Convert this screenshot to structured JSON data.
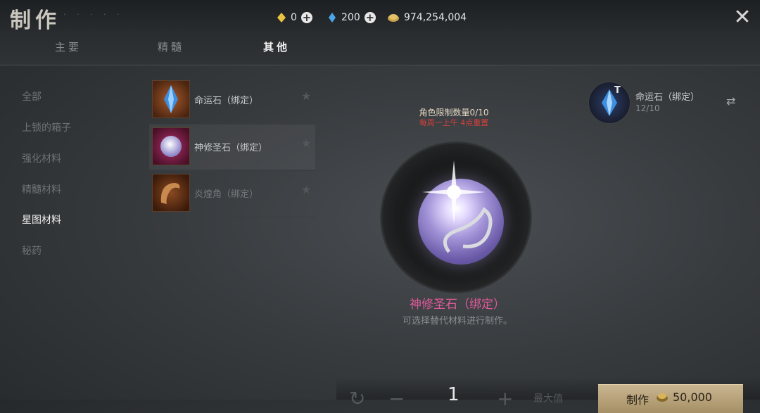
{
  "header": {
    "title": "制作",
    "currencies": [
      {
        "icon": "gold-diamond-icon",
        "value": "0"
      },
      {
        "icon": "blue-crystal-icon",
        "value": "200"
      },
      {
        "icon": "gold-coin-icon",
        "value": "974,254,004"
      }
    ],
    "tabs": [
      "主要",
      "精髓",
      "其他"
    ],
    "active_tab": "其他"
  },
  "sidebar": {
    "items": [
      "全部",
      "上锁的箱子",
      "强化材料",
      "精髓材料",
      "星图材料",
      "秘药"
    ],
    "active": "星图材料"
  },
  "recipes": [
    {
      "name": "命运石（绑定）",
      "icon": "blue-crystal-item-icon"
    },
    {
      "name": "神修圣石（绑定）",
      "icon": "holy-orb-item-icon"
    },
    {
      "name": "炎煌角（绑定）",
      "icon": "horn-item-icon"
    }
  ],
  "detail": {
    "limit_text": "角色限制数量0/10",
    "reset_text": "每周一上午 4点重置",
    "item_name": "神修圣石（绑定）",
    "description": "可选择替代材料进行制作。"
  },
  "material": {
    "badge": "T",
    "name": "命运石（绑定）",
    "count": "12/10"
  },
  "footer": {
    "quantity": "1",
    "max_label": "最大值",
    "craft_label": "制作",
    "cost": "50,000"
  },
  "colors": {
    "accent_pink": "#e05a9a",
    "warning_red": "#d0413b",
    "craft_button": "#b9a57e"
  }
}
